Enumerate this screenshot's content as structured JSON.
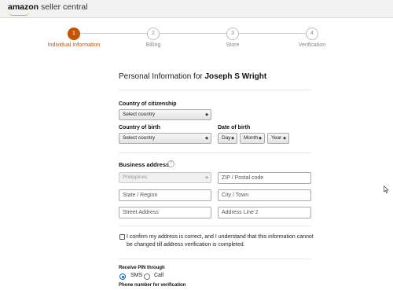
{
  "header": {
    "brand_bold": "amazon",
    "brand_rest": " seller central"
  },
  "steps": [
    {
      "number": "1",
      "label": "Individual Information",
      "active": true
    },
    {
      "number": "2",
      "label": "Billing",
      "active": false
    },
    {
      "number": "3",
      "label": "Store",
      "active": false
    },
    {
      "number": "4",
      "label": "Verification",
      "active": false
    }
  ],
  "form": {
    "title_prefix": "Personal Information for ",
    "title_name": "Joseph S Wright",
    "citizenship": {
      "label": "Country of citizenship",
      "value": "Select country"
    },
    "birth_country": {
      "label": "Country of birth",
      "value": "Select country"
    },
    "birth_date": {
      "label": "Date of birth",
      "day": "Day",
      "month": "Month",
      "year": "Year"
    },
    "address": {
      "label": "Business address",
      "country": "Philippines",
      "zip_placeholder": "ZIP / Postal code",
      "state_placeholder": "State / Region",
      "city_placeholder": "City / Town",
      "street_placeholder": "Street Address",
      "line2_placeholder": "Address Line 2"
    },
    "confirm_text": "I confirm my address is correct, and I understand that this information cannot be changed till address verification is completed.",
    "pin": {
      "label": "Receive PIN through",
      "sms": "SMS",
      "call": "Call",
      "selected": "SMS"
    },
    "phone_label": "Phone number for verification"
  },
  "colors": {
    "accent": "#c45500",
    "radio": "#0066c0",
    "logo_smile": "#f39c12"
  }
}
